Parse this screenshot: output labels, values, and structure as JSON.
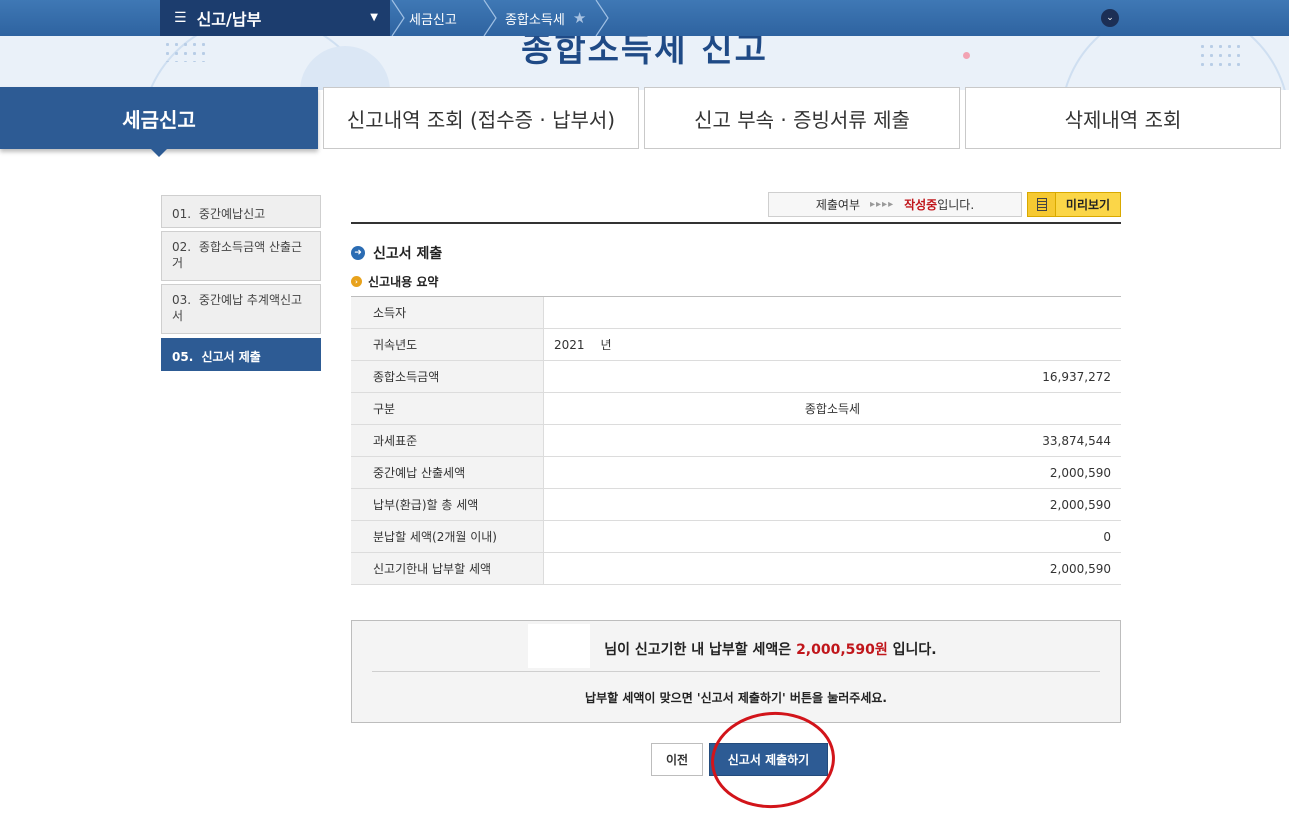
{
  "nav": {
    "menu_label": "신고/납부",
    "breadcrumb": [
      "세금신고",
      "종합소득세"
    ]
  },
  "header": {
    "title": "종합소득세 신고"
  },
  "tabs": [
    {
      "label": "세금신고"
    },
    {
      "label": "신고내역 조회 (접수증 · 납부서)"
    },
    {
      "label": "신고 부속 · 증빙서류 제출"
    },
    {
      "label": "삭제내역 조회"
    }
  ],
  "side_menu": [
    {
      "num": "01.",
      "label": "중간예납신고"
    },
    {
      "num": "02.",
      "label": "종합소득금액 산출근거"
    },
    {
      "num": "03.",
      "label": "중간예납 추계액신고서"
    },
    {
      "num": "05.",
      "label": "신고서 제출"
    }
  ],
  "status": {
    "label": "제출여부",
    "arrows": "▸▸▸▸",
    "state": "작성중",
    "suffix": "입니다.",
    "preview_label": "미리보기"
  },
  "section": {
    "title": "신고서 제출",
    "subtitle": "신고내용 요약"
  },
  "summary": {
    "rows": [
      {
        "label": "소득자",
        "value": ""
      },
      {
        "label": "귀속년도",
        "value": "2021",
        "unit": "년"
      },
      {
        "label": "종합소득금액",
        "value": "16,937,272"
      },
      {
        "label": "구분",
        "value": "종합소득세"
      },
      {
        "label": "과세표준",
        "value": "33,874,544"
      },
      {
        "label": "중간예납 산출세액",
        "value": "2,000,590"
      },
      {
        "label": "납부(환급)할 총 세액",
        "value": "2,000,590"
      },
      {
        "label": "분납할 세액(2개월 이내)",
        "value": "0"
      },
      {
        "label": "신고기한내 납부할 세액",
        "value": "2,000,590"
      }
    ]
  },
  "notice": {
    "prefix": "님이 신고기한 내 납부할 세액은",
    "amount": "2,000,590원",
    "suffix": "입니다.",
    "instruction": "납부할 세액이 맞으면 '신고서 제출하기' 버튼을 눌러주세요."
  },
  "buttons": {
    "prev": "이전",
    "submit": "신고서 제출하기"
  },
  "colors": {
    "primary": "#2d5b94",
    "accent_red": "#c0161b",
    "highlight_ring": "#d2141a",
    "preview_yellow": "#fbd648"
  }
}
